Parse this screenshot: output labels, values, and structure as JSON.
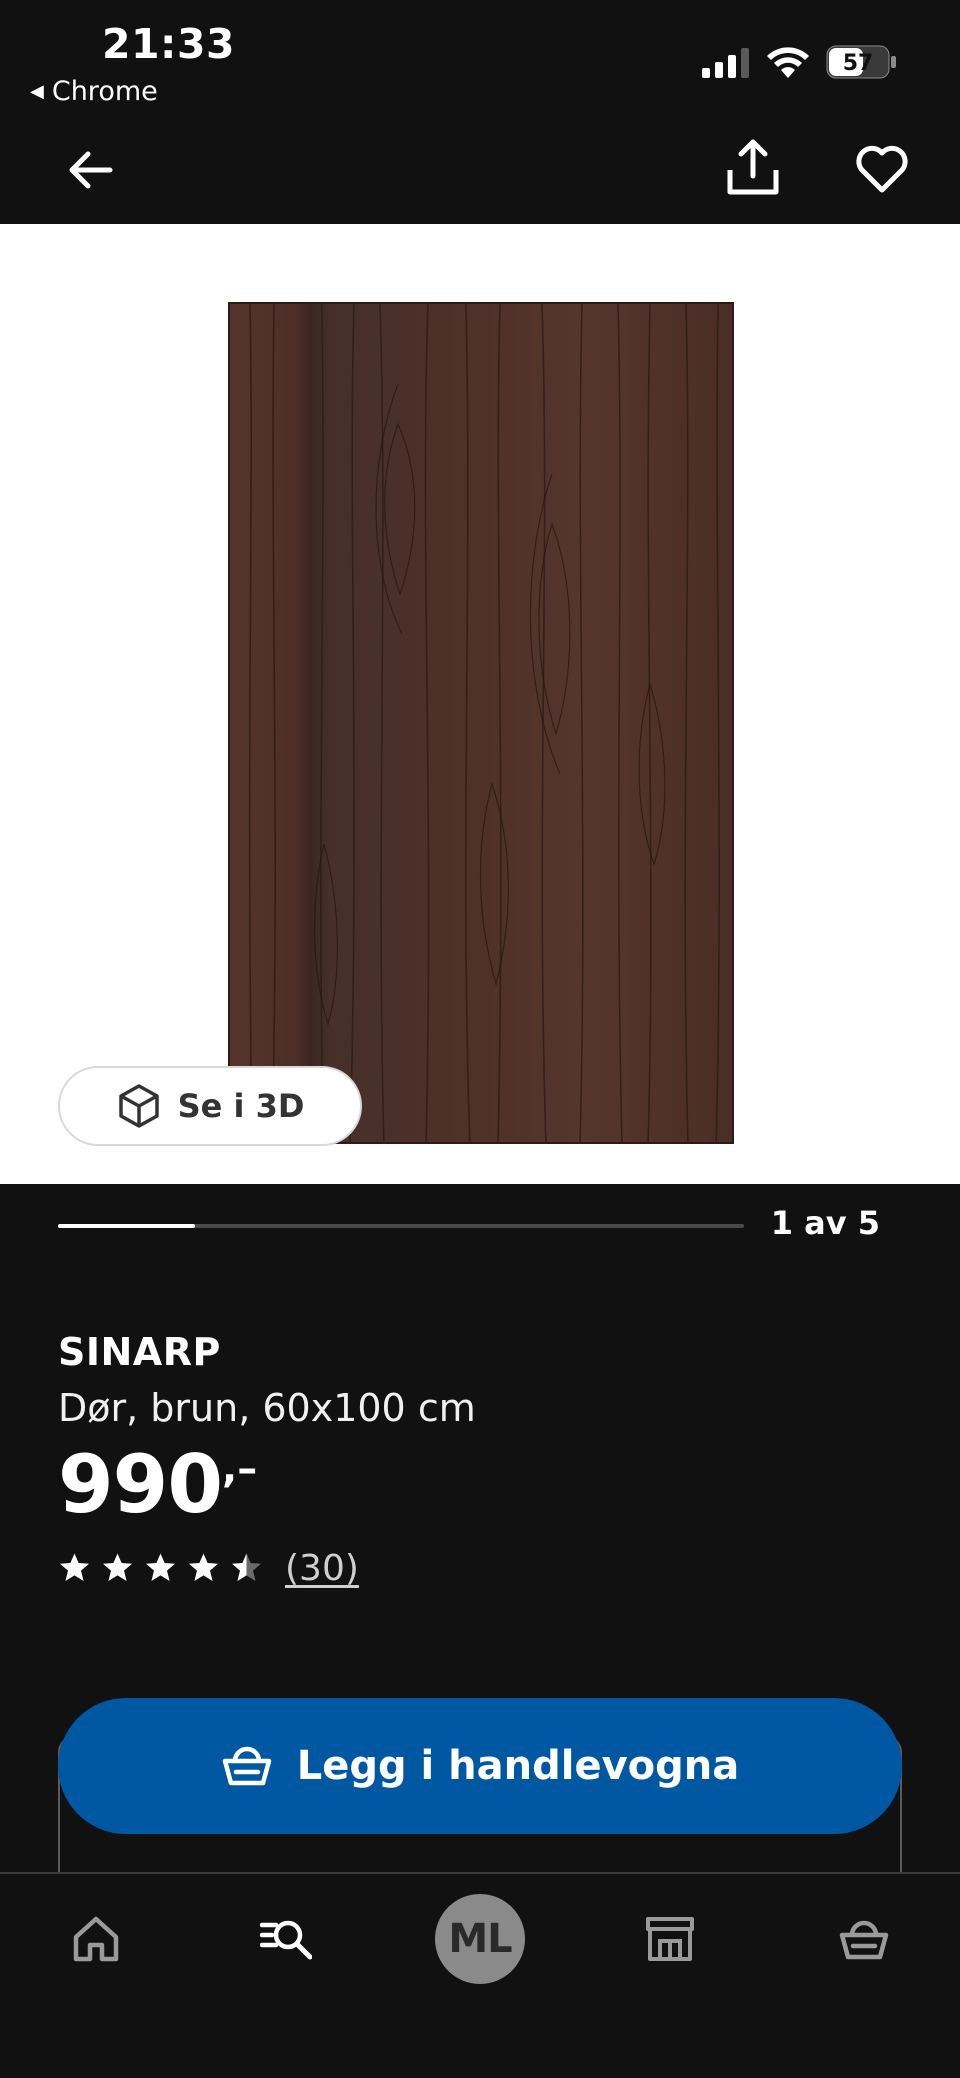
{
  "status_bar": {
    "time": "21:33",
    "back_app_label": "Chrome",
    "battery_level": "57"
  },
  "header": {
    "back_icon": "arrow-left-icon",
    "share_icon": "share-icon",
    "favorite_icon": "heart-icon"
  },
  "gallery": {
    "view_3d_label": "Se i 3D",
    "current_index": 1,
    "total_images": 5,
    "counter_text": "1 av 5",
    "progress_fraction": 0.2
  },
  "product": {
    "name": "SINARP",
    "description": "Dør, brun, 60x100 cm",
    "price": "990",
    "price_suffix": ",–",
    "rating": 4.5,
    "rating_max": 5,
    "review_count": "(30)"
  },
  "actions": {
    "add_to_cart_label": "Legg i handlevogna"
  },
  "tab_bar": {
    "profile_initials": "ML",
    "icons": [
      "home-icon",
      "search-icon",
      "profile-avatar",
      "store-icon",
      "cart-icon"
    ]
  },
  "colors": {
    "background": "#111111",
    "accent_blue": "#0058a3",
    "wood_brown": "#4a2d25"
  }
}
